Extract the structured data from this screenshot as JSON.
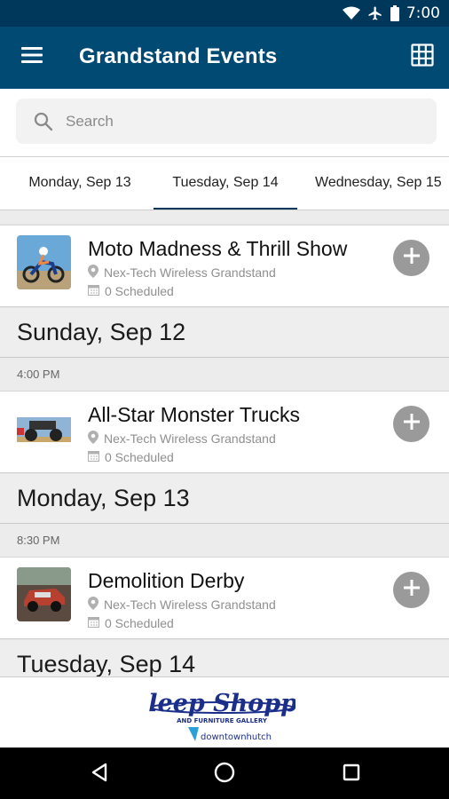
{
  "status_bar": {
    "time": "7:00"
  },
  "app_bar": {
    "title": "Grandstand Events"
  },
  "search": {
    "placeholder": "Search",
    "value": ""
  },
  "tabs": [
    {
      "label": "Monday, Sep 13",
      "active": false
    },
    {
      "label": "Tuesday, Sep 14",
      "active": true
    },
    {
      "label": "Wednesday, Sep 15",
      "active": false
    }
  ],
  "list": {
    "events": [
      {
        "title": "Moto Madness & Thrill Show",
        "venue": "Nex-Tech Wireless Grandstand",
        "scheduled": "0 Scheduled"
      },
      {
        "title": "All-Star Monster Trucks",
        "venue": "Nex-Tech Wireless Grandstand",
        "scheduled": "0 Scheduled"
      },
      {
        "title": "Demolition Derby",
        "venue": "Nex-Tech Wireless Grandstand",
        "scheduled": "0 Scheduled"
      }
    ],
    "days": [
      {
        "label": "Sunday, Sep 12",
        "time": "4:00 PM"
      },
      {
        "label": "Monday, Sep 13",
        "time": "8:30 PM"
      },
      {
        "label": "Tuesday, Sep 14"
      }
    ]
  },
  "ad": {
    "brand_line1": "Sleep Shoppe",
    "brand_line2": "AND FURNITURE GALLERY",
    "sponsor": "downtownhutch"
  },
  "colors": {
    "status_bar": "#00385c",
    "app_bar": "#004a74",
    "accent": "#00385c",
    "add_button": "#9a9a9a"
  }
}
